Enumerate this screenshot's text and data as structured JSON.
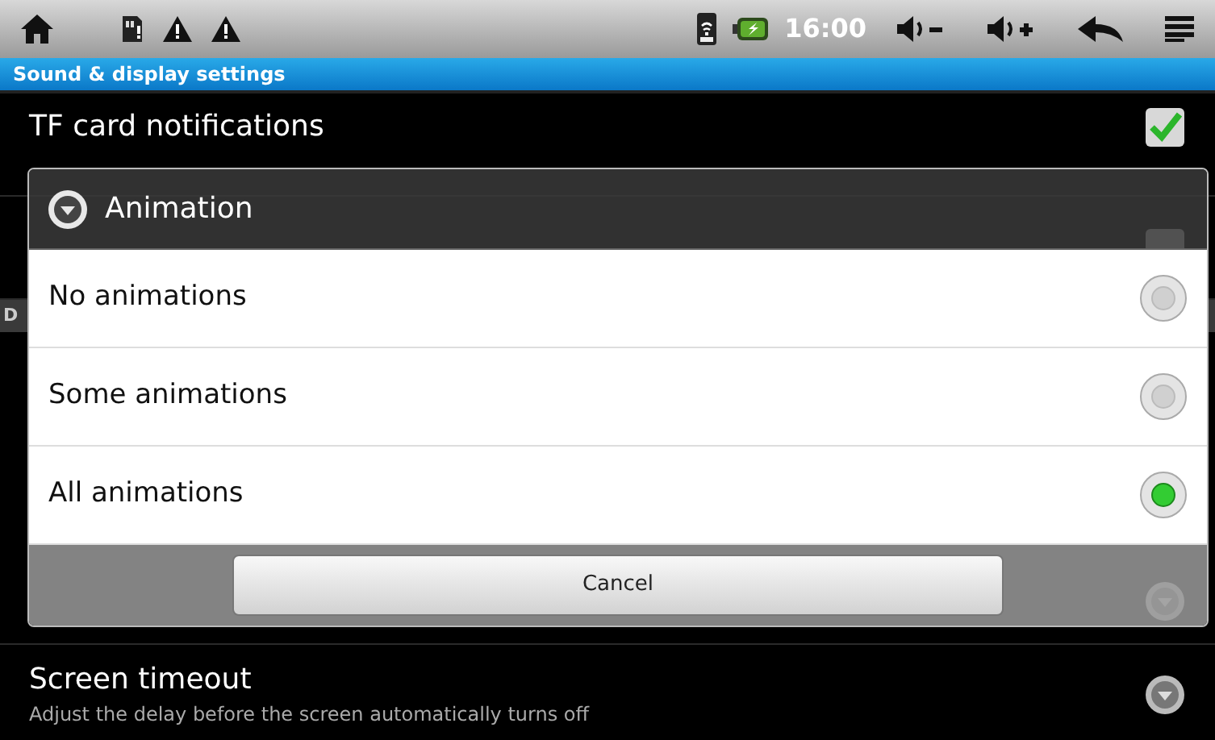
{
  "status_bar": {
    "time": "16:00"
  },
  "title_bar": {
    "title": "Sound & display settings"
  },
  "settings": [
    {
      "kind": "checkbox",
      "title": "TF card notifications",
      "checked": true
    },
    {
      "kind": "checkbox",
      "checked": false
    },
    {
      "kind": "header",
      "title": "D"
    },
    {
      "kind": "spacer"
    },
    {
      "kind": "list"
    },
    {
      "kind": "list",
      "title": "Screen timeout",
      "summary": "Adjust the delay before the screen automatically turns off"
    }
  ],
  "dialog": {
    "title": "Animation",
    "options": [
      {
        "label": "No animations",
        "selected": false
      },
      {
        "label": "Some animations",
        "selected": false
      },
      {
        "label": "All animations",
        "selected": true
      }
    ],
    "button": "Cancel"
  }
}
